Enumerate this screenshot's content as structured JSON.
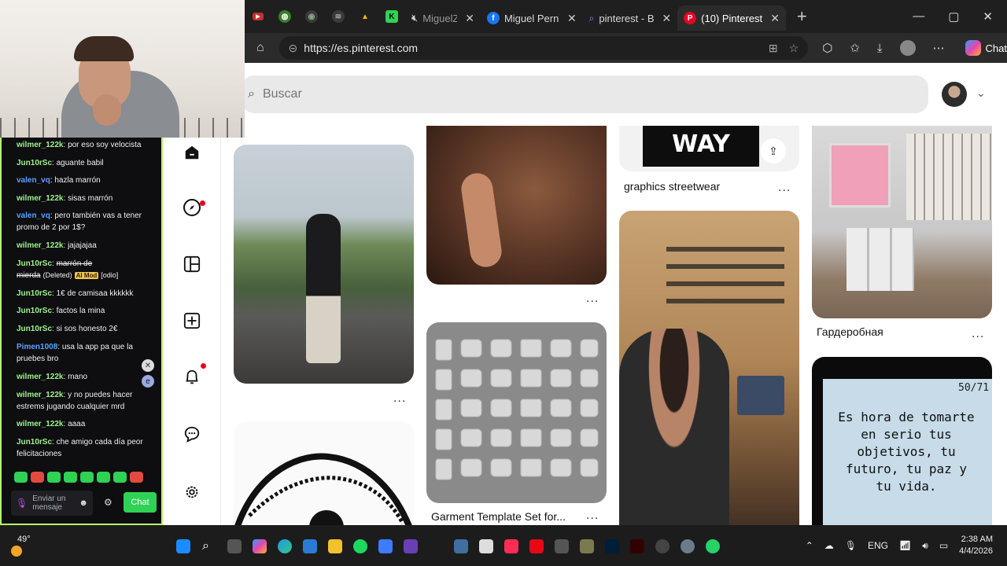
{
  "browser": {
    "tabs": [
      {
        "label": "MiguelZ",
        "icon": "muted-speaker-icon",
        "active": false
      },
      {
        "label": "Miguel Pernía",
        "icon": "facebook-icon",
        "active": false
      },
      {
        "label": "pinterest - Bi",
        "icon": "search-icon",
        "active": false
      },
      {
        "label": "(10) Pinterest",
        "icon": "pinterest-icon",
        "active": true
      }
    ],
    "url": "https://es.pinterest.com",
    "copilot_label": "Chat"
  },
  "pinterest": {
    "search_placeholder": "Buscar",
    "captions": {
      "graphics": "graphics streetwear",
      "wardrobe": "Гардеробная",
      "garment": "Garment Template Set for..."
    },
    "quote": "Es hora de tomarte en serio tus objetivos, tu futuro, tu paz y tu vida.",
    "quote_counter": "50/71",
    "way_text": "WAY",
    "more_label": "..."
  },
  "chat": {
    "messages": [
      {
        "user": "wilmer_122k",
        "text": "por eso soy velocista",
        "color": "g"
      },
      {
        "user": "Jun10rSc",
        "text": "aguante babil",
        "color": "g"
      },
      {
        "user": "valen_vq",
        "text": "hazla marrón",
        "color": "b"
      },
      {
        "user": "wilmer_122k",
        "text": "sisas marrón",
        "color": "g"
      },
      {
        "user": "valen_vq",
        "text": "pero también vas a tener promo de 2 por 1$?",
        "color": "b"
      },
      {
        "user": "wilmer_122k",
        "text": "jajajajaa",
        "color": "g"
      },
      {
        "user": "Jun10rSc",
        "text": "marrón de mierda",
        "color": "g",
        "deleted": true
      },
      {
        "user": "Jun10rSc",
        "text": "1€ de camisaa kkkkkk",
        "color": "g"
      },
      {
        "user": "Jun10rSc",
        "text": "factos la mina",
        "color": "g"
      },
      {
        "user": "Jun10rSc",
        "text": "si sos honesto 2€",
        "color": "g"
      },
      {
        "user": "Pimen1008",
        "text": "usa la app pa que la pruebes bro",
        "color": "b"
      },
      {
        "user": "wilmer_122k",
        "text": "mano",
        "color": "g"
      },
      {
        "user": "wilmer_122k",
        "text": "y no puedes hacer estrems jugando cualquier mrd",
        "color": "g"
      },
      {
        "user": "wilmer_122k",
        "text": "aaaa",
        "color": "g"
      },
      {
        "user": "Jun10rSc",
        "text": "che amigo cada día peor felicitaciones",
        "color": "g"
      }
    ],
    "deleted_label": "(Deleted)",
    "ai_mod_label": "AI Mod",
    "odio_label": "[odio]",
    "input_placeholder": "Enviar un mensaje",
    "send_label": "Chat"
  },
  "taskbar": {
    "temperature": "49°",
    "lang": "ENG",
    "time": "2:38 AM",
    "date": "4/4/2026"
  }
}
